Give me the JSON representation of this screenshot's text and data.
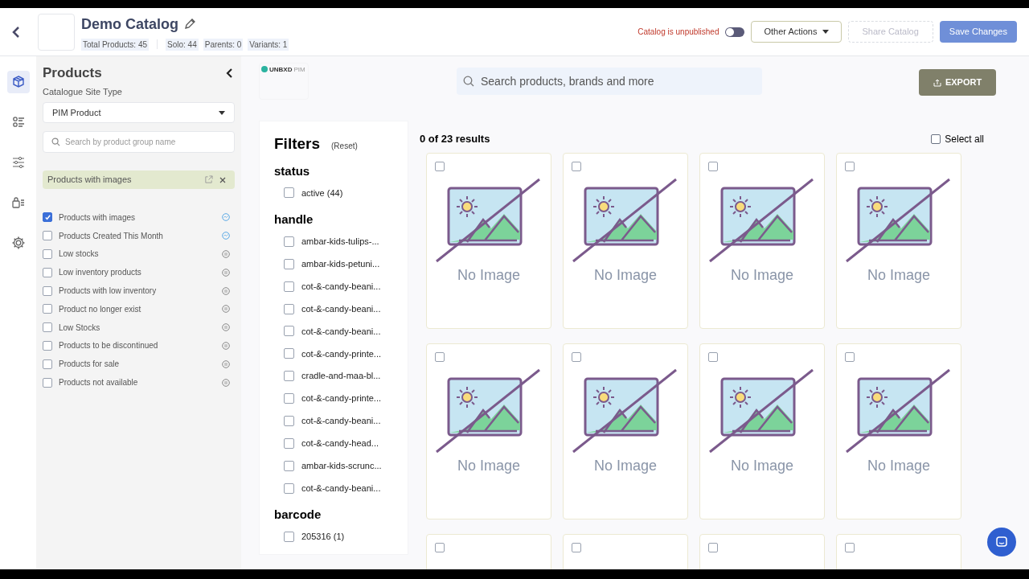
{
  "header": {
    "title": "Demo Catalog",
    "stats": [
      "Total Products: 45",
      "Solo: 44",
      "Parents: 0",
      "Variants: 1"
    ],
    "publish_status": "Catalog is unpublished",
    "published": false,
    "buttons": [
      {
        "label": "Other Actions",
        "kind": "dropdown",
        "disabled": false
      },
      {
        "label": "Share Catalog",
        "kind": "outline",
        "disabled": true
      },
      {
        "label": "Save Changes",
        "kind": "primary",
        "disabled": false
      }
    ]
  },
  "rail": [
    {
      "selected": true
    },
    {
      "selected": false
    },
    {
      "selected": false
    },
    {
      "selected": false
    },
    {
      "selected": false
    }
  ],
  "sidebar": {
    "title": "Products",
    "site_type_label": "Catalogue Site Type",
    "site_type": "PIM Product",
    "search_placeholder": "Search by product group name",
    "active_group": "Products with images",
    "groups": [
      {
        "label": "Products with images",
        "checked": true,
        "kind": "smart"
      },
      {
        "label": "Products Created This Month",
        "checked": false,
        "kind": "smart"
      },
      {
        "label": "Low stocks",
        "checked": false,
        "kind": "manual"
      },
      {
        "label": "Low inventory products",
        "checked": false,
        "kind": "manual"
      },
      {
        "label": "Products with low inventory",
        "checked": false,
        "kind": "manual"
      },
      {
        "label": "Product no longer exist",
        "checked": false,
        "kind": "manual"
      },
      {
        "label": "Low Stocks",
        "checked": false,
        "kind": "manual"
      },
      {
        "label": "Products to be discontinued",
        "checked": false,
        "kind": "manual"
      },
      {
        "label": "Products for sale",
        "checked": false,
        "kind": "manual"
      },
      {
        "label": "Products not available",
        "checked": false,
        "kind": "manual"
      }
    ]
  },
  "preview": {
    "logo_text": "UNBXD",
    "logo_suffix": "PIM",
    "search_placeholder": "Search products, brands and more",
    "export_label": "EXPORT",
    "filters": {
      "title": "Filters",
      "reset": "(Reset)",
      "groups": [
        {
          "name": "status",
          "options": [
            {
              "label": "active (44)",
              "checked": false
            }
          ]
        },
        {
          "name": "handle",
          "options": [
            {
              "label": "ambar-kids-tulips-...",
              "checked": false
            },
            {
              "label": "ambar-kids-petuni...",
              "checked": false
            },
            {
              "label": "cot-&-candy-beani...",
              "checked": false
            },
            {
              "label": "cot-&-candy-beani...",
              "checked": false
            },
            {
              "label": "cot-&-candy-beani...",
              "checked": false
            },
            {
              "label": "cot-&-candy-printe...",
              "checked": false
            },
            {
              "label": "cradle-and-maa-bl...",
              "checked": false
            },
            {
              "label": "cot-&-candy-printe...",
              "checked": false
            },
            {
              "label": "cot-&-candy-beani...",
              "checked": false
            },
            {
              "label": "cot-&-candy-head...",
              "checked": false
            },
            {
              "label": "ambar-kids-scrunc...",
              "checked": false
            },
            {
              "label": "cot-&-candy-beani...",
              "checked": false
            }
          ]
        },
        {
          "name": "barcode",
          "options": [
            {
              "label": "205316 (1)",
              "checked": false
            }
          ]
        }
      ]
    },
    "results_count": "0 of 23 results",
    "select_all": {
      "label": "Select all",
      "checked": false
    },
    "cards": [
      {
        "checked": false,
        "caption": "No Image"
      },
      {
        "checked": false,
        "caption": "No Image"
      },
      {
        "checked": false,
        "caption": "No Image"
      },
      {
        "checked": false,
        "caption": "No Image"
      },
      {
        "checked": false,
        "caption": "No Image"
      },
      {
        "checked": false,
        "caption": "No Image"
      },
      {
        "checked": false,
        "caption": "No Image"
      },
      {
        "checked": false,
        "caption": "No Image"
      },
      {
        "checked": false
      },
      {
        "checked": false
      },
      {
        "checked": false
      },
      {
        "checked": false
      }
    ]
  }
}
